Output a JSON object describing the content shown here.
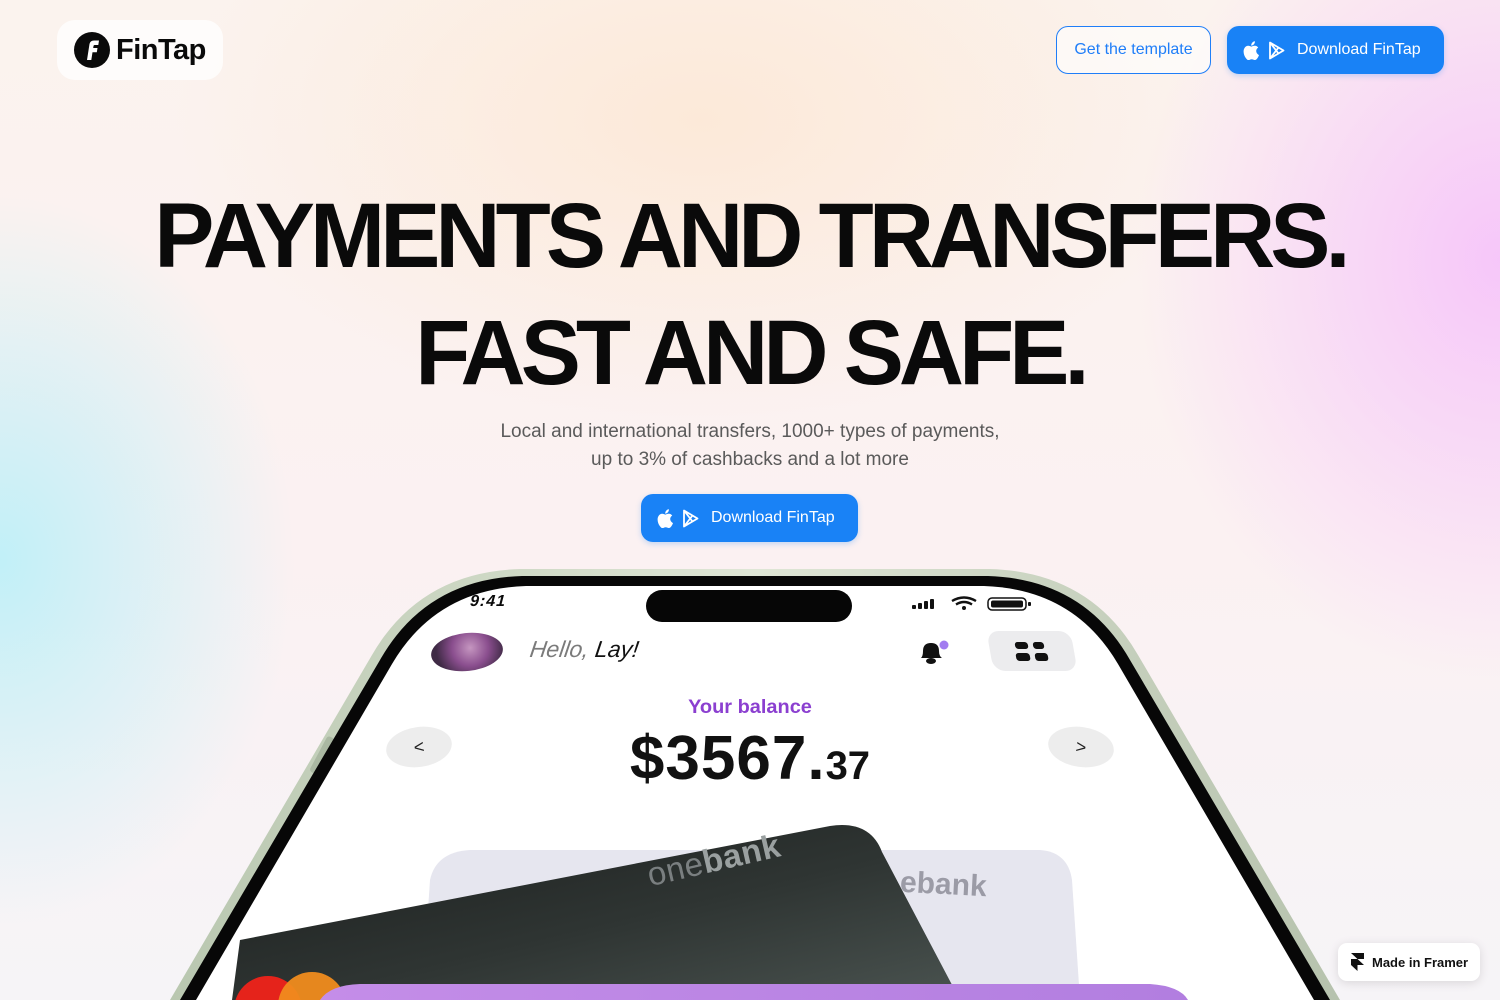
{
  "header": {
    "logo_text": "FinTap",
    "template_button": "Get the template",
    "download_button": "Download FinTap"
  },
  "hero": {
    "headline_line1": "PAYMENTS AND TRANSFERS.",
    "headline_line2": "FAST AND SAFE.",
    "subtitle": "Local and international transfers, 1000+ types of payments, up to 3% of cashbacks and a lot more",
    "cta_button": "Download FinTap"
  },
  "phone": {
    "status_time": "9:41",
    "greeting_hello": "Hello,",
    "greeting_name": "Lay!",
    "balance_label": "Your balance",
    "balance_main": "$3567.",
    "balance_cents": "37",
    "prev_label": "<",
    "next_label": ">",
    "card_front_brand_a": "one",
    "card_front_brand_b": "bank",
    "card_back_brand": "ebank"
  },
  "badge": {
    "label": "Made in Framer"
  },
  "colors": {
    "accent": "#1982f6",
    "balance_label": "#8b3fd0",
    "text": "#0a0a0a"
  }
}
